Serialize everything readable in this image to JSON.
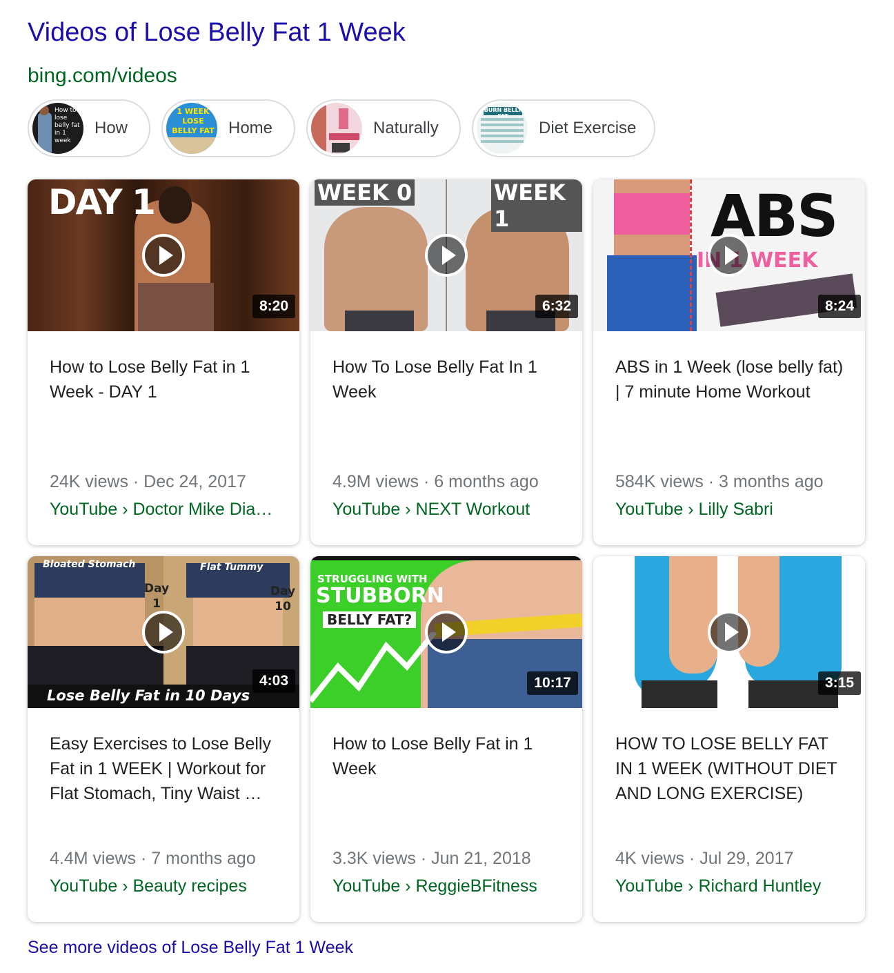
{
  "header": {
    "title": "Videos of Lose Belly Fat 1 Week",
    "source": "bing.com/videos"
  },
  "chips": [
    {
      "label": "How",
      "thumb_text": "How to lose belly fat in 1 week"
    },
    {
      "label": "Home",
      "thumb_text": "1 WEEK LOSE BELLY FAT"
    },
    {
      "label": "Naturally"
    },
    {
      "label": "Diet Exercise",
      "thumb_text": "BURN BELLY FAT"
    }
  ],
  "videos": [
    {
      "title": "How to Lose Belly Fat in 1 Week - DAY 1",
      "duration": "8:20",
      "meta": "24K views · Dec 24, 2017",
      "source": "YouTube › Doctor Mike Dia…",
      "overlay": [
        "DAY 1"
      ]
    },
    {
      "title": "How To Lose Belly Fat In 1 Week",
      "duration": "6:32",
      "meta": "4.9M views · 6 months ago",
      "source": "YouTube › NEXT Workout",
      "overlay": [
        "WEEK 0",
        "WEEK 1"
      ]
    },
    {
      "title": "ABS in 1 Week (lose belly fat) | 7 minute Home Workout",
      "duration": "8:24",
      "meta": "584K views · 3 months ago",
      "source": "YouTube › Lilly Sabri",
      "overlay": [
        "ABS",
        "IN 1 WEEK"
      ]
    },
    {
      "title": "Easy Exercises to Lose Belly Fat in 1 WEEK | Workout for Flat Stomach, Tiny Waist …",
      "duration": "4:03",
      "meta": "4.4M views · 7 months ago",
      "source": "YouTube › Beauty recipes",
      "overlay": [
        "Bloated Stomach",
        "Flat Tummy",
        "Day 1",
        "Day 10",
        "Lose Belly Fat in 10 Days"
      ]
    },
    {
      "title": "How to Lose Belly Fat in 1 Week",
      "duration": "10:17",
      "meta": "3.3K views · Jun 21, 2018",
      "source": "YouTube › ReggieBFitness",
      "overlay": [
        "STRUGGLING WITH",
        "STUBBORN",
        "BELLY FAT?"
      ]
    },
    {
      "title": "HOW TO LOSE BELLY FAT IN 1 WEEK (WITHOUT DIET AND LONG EXERCISE)",
      "duration": "3:15",
      "meta": "4K views · Jul 29, 2017",
      "source": "YouTube › Richard Huntley"
    }
  ],
  "footer": {
    "see_more": "See more videos of Lose Belly Fat 1 Week"
  },
  "colors": {
    "link": "#1a0dab",
    "url_green": "#006621",
    "meta_gray": "#70757a"
  }
}
